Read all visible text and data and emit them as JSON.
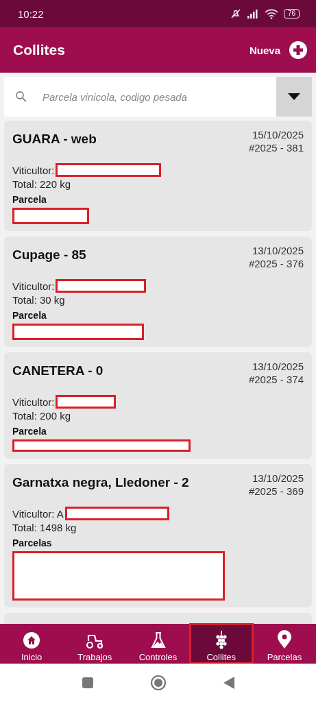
{
  "status_bar": {
    "time": "10:22",
    "battery": "76"
  },
  "header": {
    "title": "Collites",
    "new_button": "Nueva"
  },
  "search": {
    "placeholder": "Parcela vinicola, codigo pesada"
  },
  "cards": [
    {
      "title": "GUARA - web",
      "date": "15/10/2025",
      "code": "#2025 - 381",
      "grower_label": "Viticultor:",
      "total": "Total: 220 kg",
      "plots_label": "Parcela",
      "grower_redacted": true,
      "plots_redacted": true
    },
    {
      "title": "Cupage - 85",
      "date": "13/10/2025",
      "code": "#2025 - 376",
      "grower_label": "Viticultor:",
      "total": "Total: 30 kg",
      "plots_label": "Parcela",
      "grower_redacted": true,
      "plots_redacted": true
    },
    {
      "title": "CANETERA - 0",
      "date": "13/10/2025",
      "code": "#2025 - 374",
      "grower_label": "Viticultor:",
      "total": "Total: 200 kg",
      "plots_label": "Parcela",
      "grower_redacted": true,
      "plots_redacted": true
    },
    {
      "title": "Garnatxa negra, Lledoner - 2",
      "date": "13/10/2025",
      "code": "#2025 - 369",
      "grower_label": "Viticultor: A",
      "total": "Total: 1498 kg",
      "plots_label": "Parcelas",
      "grower_redacted": true,
      "plots_redacted": true
    }
  ],
  "nav": [
    {
      "label": "Inicio",
      "kind": "home",
      "selected": false
    },
    {
      "label": "Trabajos",
      "kind": "tractor",
      "selected": false
    },
    {
      "label": "Controles",
      "kind": "flask",
      "selected": false
    },
    {
      "label": "Collites",
      "kind": "grapes",
      "selected": true
    },
    {
      "label": "Parcelas",
      "kind": "pin",
      "selected": false
    }
  ]
}
